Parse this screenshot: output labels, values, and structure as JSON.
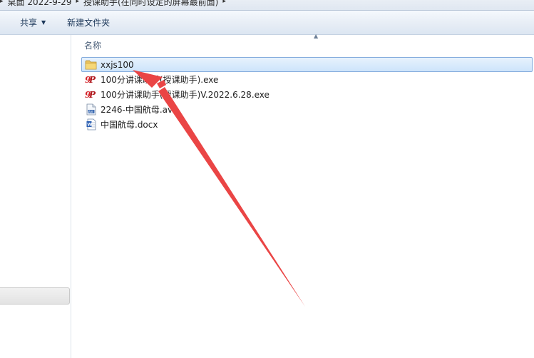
{
  "address_bar": {
    "crumbs": [
      "桌面 2022-9-29",
      "授课助手(在同时设定的屏幕最前面)"
    ]
  },
  "toolbar": {
    "share_label": "共享",
    "new_folder_label": "新建文件夹"
  },
  "list": {
    "column_name": "名称",
    "files": [
      {
        "name": "xxjs100",
        "icon": "folder-icon",
        "selected": true
      },
      {
        "name": "100分讲课助手(授课助手).exe",
        "icon": "app-exe-icon",
        "selected": false
      },
      {
        "name": "100分讲课助手(授课助手)V.2022.6.28.exe",
        "icon": "app-exe-icon",
        "selected": false
      },
      {
        "name": "2246-中国航母.avi",
        "icon": "video-file-icon",
        "selected": false
      },
      {
        "name": "中国航母.docx",
        "icon": "word-doc-icon",
        "selected": false
      }
    ]
  },
  "colors": {
    "selection": "#cde4fb",
    "arrow": "#ea4545",
    "toolbar": "#dce6f2"
  }
}
